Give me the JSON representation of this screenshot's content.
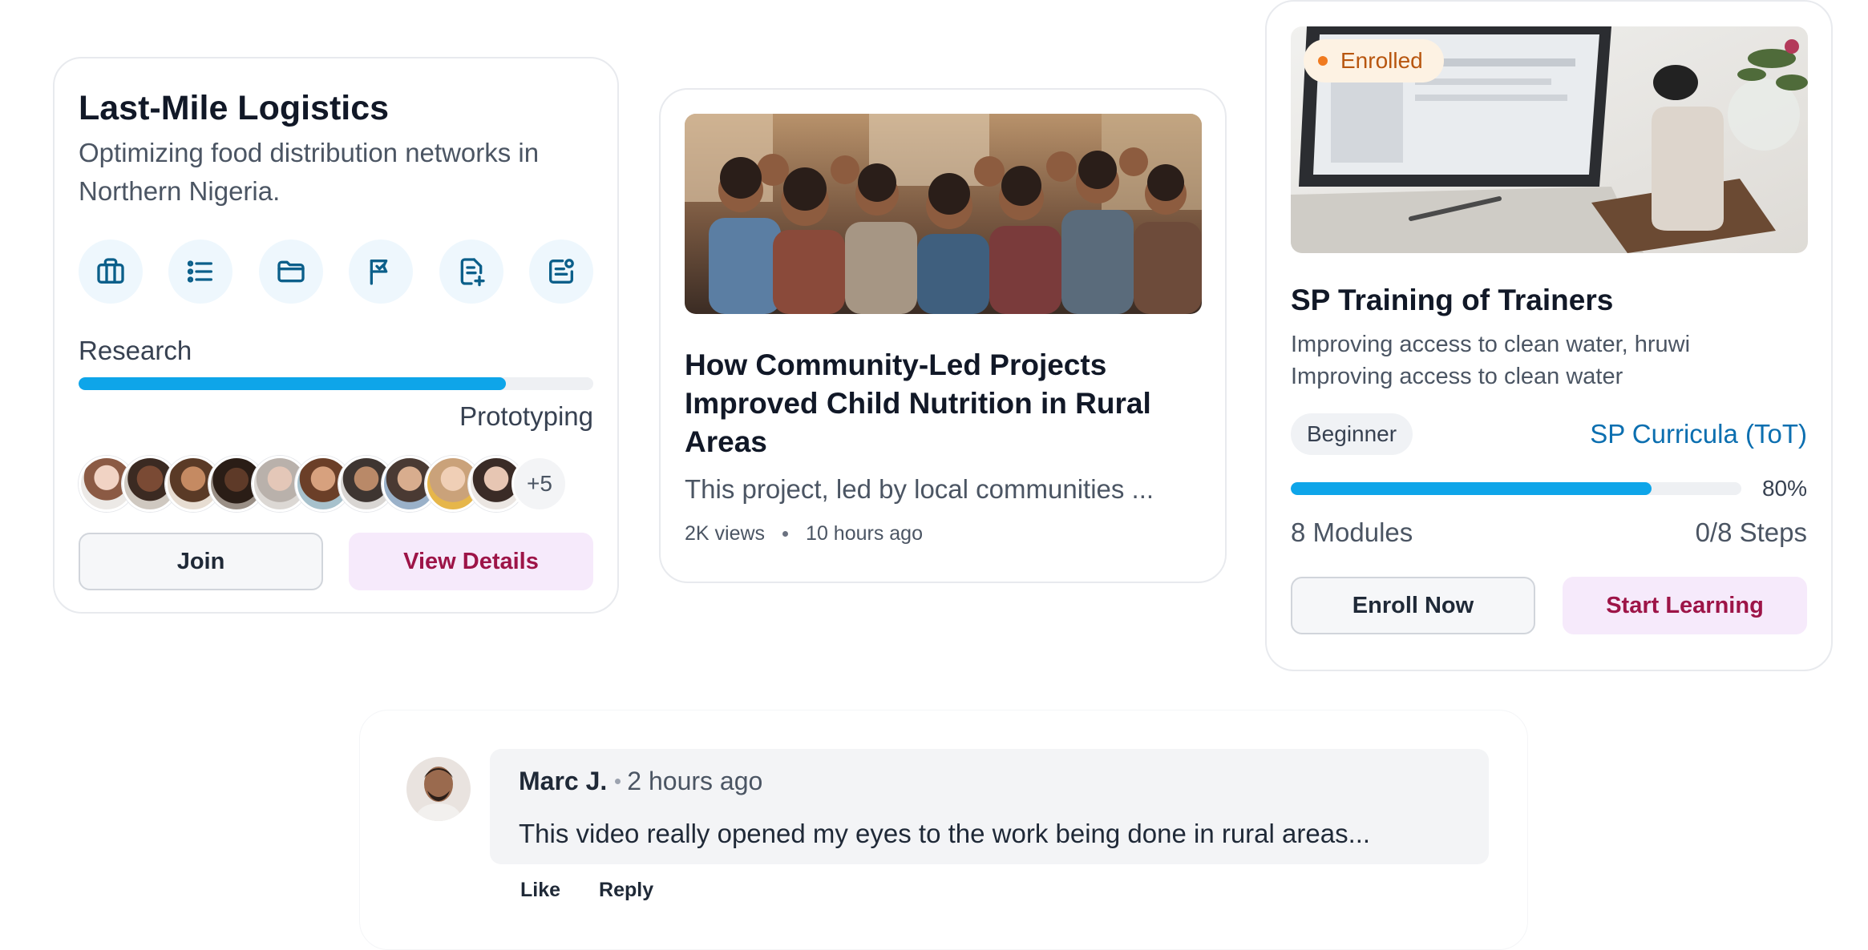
{
  "project_card": {
    "title": "Last-Mile Logistics",
    "description": "Optimizing food distribution networks in Northern Nigeria.",
    "icons": [
      "briefcase-icon",
      "list-icon",
      "folder-icon",
      "flag-icon",
      "document-add-icon",
      "document-settings-icon"
    ],
    "current_stage": "Research",
    "next_stage": "Prototyping",
    "progress": 0.83,
    "member_overflow": "+5",
    "join_label": "Join",
    "details_label": "View Details",
    "accent_color": "#0ea5e9"
  },
  "article_card": {
    "title": "How Community-Led Projects Improved Child Nutrition in Rural Areas",
    "excerpt": "This project, led by local communities ...",
    "views": "2K views",
    "time": "10 hours ago"
  },
  "course_card": {
    "badge": "Enrolled",
    "title": "SP Training of Trainers",
    "description_line1": "Improving access to clean water, hruwi",
    "description_line2": "Improving access to clean water",
    "level": "Beginner",
    "curriculum": "SP Curricula (ToT)",
    "progress_percent": 80,
    "progress_label": "80%",
    "modules": "8 Modules",
    "steps": "0/8 Steps",
    "enroll_label": "Enroll Now",
    "start_label": "Start Learning"
  },
  "comment": {
    "author": "Marc J.",
    "time": "2 hours ago",
    "text": "This video really opened my eyes to the work being done in rural areas...",
    "like_label": "Like",
    "reply_label": "Reply"
  }
}
